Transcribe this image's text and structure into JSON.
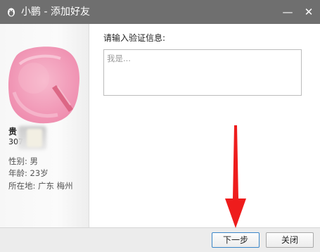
{
  "window": {
    "title": "小鹏 - 添加好友",
    "minimize_glyph": "—",
    "close_glyph": "✕"
  },
  "profile": {
    "name": "贵",
    "qq_partial": "307",
    "gender": "性别: 男",
    "age": "年龄: 23岁",
    "location": "所在地: 广东  梅州"
  },
  "form": {
    "label": "请输入验证信息:",
    "placeholder": "我是..."
  },
  "buttons": {
    "next": "下一步",
    "close": "关闭"
  },
  "colors": {
    "titlebar": "#6f6f6f",
    "avatar_pink": "#f4a6c0",
    "arrow_red": "#ee1c1c"
  },
  "icons": {
    "title": "penguin-icon",
    "avatar": "default-avatar-icon"
  }
}
